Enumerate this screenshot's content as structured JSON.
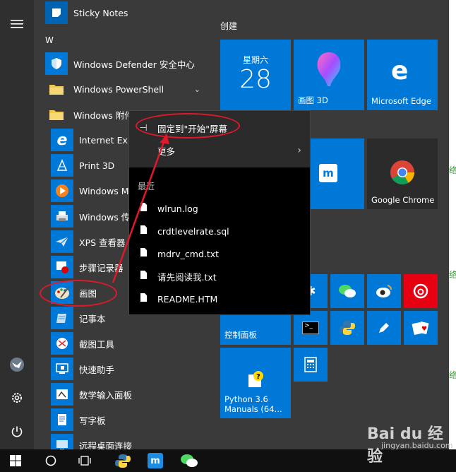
{
  "rail": {
    "menu_icon": "hamburger-icon",
    "user_icon": "user-avatar-icon",
    "settings_icon": "gear-icon",
    "power_icon": "power-icon"
  },
  "applist": {
    "letter_w": "W",
    "items": [
      {
        "label": "Sticky Notes"
      },
      {
        "label": "Windows Defender 安全中心"
      },
      {
        "label": "Windows PowerShell"
      },
      {
        "label": "Windows 附件"
      },
      {
        "label": "Internet Exp"
      },
      {
        "label": "Print 3D"
      },
      {
        "label": "Windows Me"
      },
      {
        "label": "Windows 传"
      },
      {
        "label": "XPS 查看器"
      },
      {
        "label": "步骤记录器"
      },
      {
        "label": "画图"
      },
      {
        "label": "记事本"
      },
      {
        "label": "截图工具"
      },
      {
        "label": "快速助手"
      },
      {
        "label": "数学输入面板"
      },
      {
        "label": "写字板"
      },
      {
        "label": "远程桌面连接"
      }
    ]
  },
  "tiles": {
    "group_title": "创建",
    "calendar": {
      "weekday": "星期六",
      "day": "28"
    },
    "paint3d": "画图 3D",
    "edge": "Microsoft Edge",
    "partial": "游5",
    "chrome": "Google Chrome",
    "control_panel": "控制面板",
    "python": "Python 3.6 Manuals (64..."
  },
  "context_menu": {
    "pin": "固定到\"开始\"屏幕",
    "more": "更多",
    "recent_header": "最近",
    "recent": [
      {
        "label": "wlrun.log"
      },
      {
        "label": "crdtlevelrate.sql"
      },
      {
        "label": "mdrv_cmd.txt"
      },
      {
        "label": "请先阅读我.txt"
      },
      {
        "label": "README.HTM"
      }
    ]
  },
  "watermark": {
    "main": "Bai du 经验",
    "sub": "jingyan.baidu.com"
  },
  "colors": {
    "tile_blue": "#0078d7",
    "annotation_red": "#e0192a",
    "taskbar": "#101010"
  }
}
